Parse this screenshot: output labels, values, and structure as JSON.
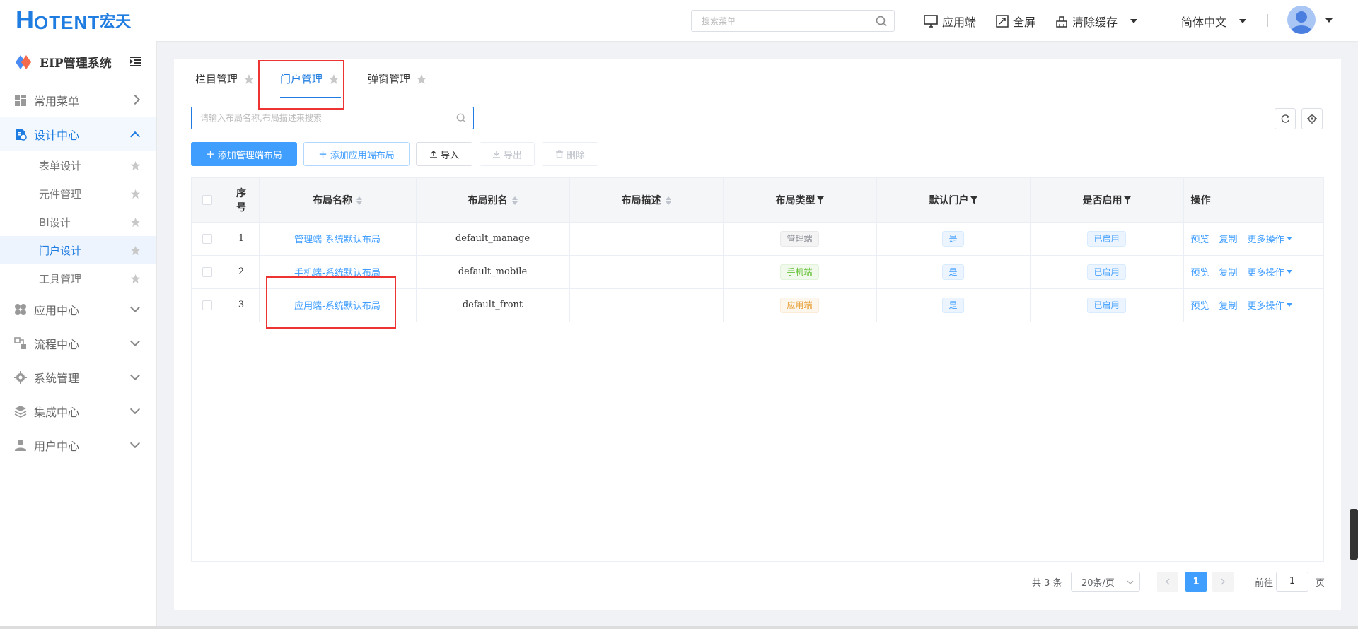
{
  "header": {
    "logo_h": "H",
    "logo_otent": "OTENT",
    "logo_cn": "宏天",
    "search_placeholder": "搜索菜单",
    "app_end": "应用端",
    "fullscreen": "全屏",
    "clear_cache": "清除缓存",
    "language": "简体中文"
  },
  "sidebar": {
    "brand": "EIP管理系统",
    "menu": {
      "common": "常用菜单",
      "design": "设计中心",
      "app": "应用中心",
      "flow": "流程中心",
      "system": "系统管理",
      "integration": "集成中心",
      "user": "用户中心"
    },
    "design_sub": [
      "表单设计",
      "元件管理",
      "BI设计",
      "门户设计",
      "工具管理"
    ]
  },
  "tabs": [
    "栏目管理",
    "门户管理",
    "弹窗管理"
  ],
  "toolbar": {
    "search_placeholder": "请输入布局名称,布局描述来搜索",
    "add_manage": "添加管理端布局",
    "add_app": "添加应用端布局",
    "import": "导入",
    "export": "导出",
    "delete": "删除"
  },
  "table": {
    "headers": {
      "index_1": "序",
      "index_2": "号",
      "name": "布局名称",
      "alias": "布局别名",
      "desc": "布局描述",
      "type": "布局类型",
      "default": "默认门户",
      "enabled": "是否启用",
      "ops": "操作"
    },
    "rows": [
      {
        "idx": "1",
        "name": "管理端-系统默认布局",
        "alias": "default_manage",
        "desc": "",
        "type": "管理端",
        "default": "是",
        "enabled": "已启用"
      },
      {
        "idx": "2",
        "name": "手机端-系统默认布局",
        "alias": "default_mobile",
        "desc": "",
        "type": "手机端",
        "default": "是",
        "enabled": "已启用"
      },
      {
        "idx": "3",
        "name": "应用端-系统默认布局",
        "alias": "default_front",
        "desc": "",
        "type": "应用端",
        "default": "是",
        "enabled": "已启用"
      }
    ],
    "op_preview": "预览",
    "op_copy": "复制",
    "op_more": "更多操作"
  },
  "pagination": {
    "total": "共 3 条",
    "page_size": "20条/页",
    "current": "1",
    "goto_label": "前往",
    "goto_value": "1",
    "page_unit": "页"
  },
  "colors": {
    "primary": "#409eff",
    "brand": "#1f7ce0",
    "highlight_box": "#ee3333"
  }
}
